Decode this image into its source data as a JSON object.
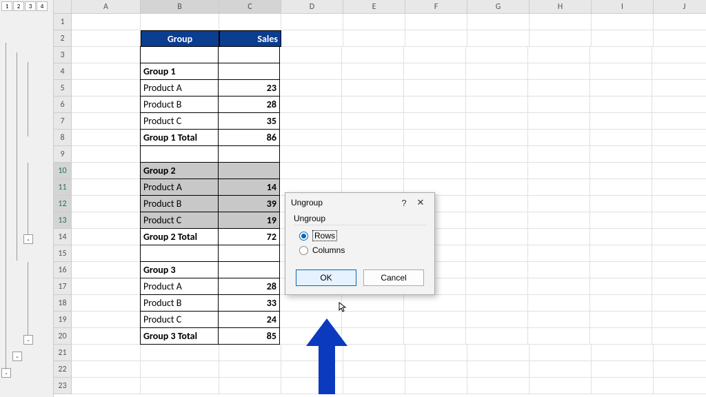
{
  "outline_levels": [
    "1",
    "2",
    "3",
    "4"
  ],
  "columns": [
    "A",
    "B",
    "C",
    "D",
    "E",
    "F",
    "G",
    "H",
    "I",
    "J"
  ],
  "col_widths": {
    "A": 100,
    "B": 114,
    "C": 90,
    "default": 90
  },
  "rows": [
    {
      "num": "1"
    },
    {
      "num": "2",
      "B": "Group",
      "C": "Sales",
      "header": true
    },
    {
      "num": "3",
      "bordered": true
    },
    {
      "num": "4",
      "B": "Group 1",
      "bold": true,
      "bordered": true
    },
    {
      "num": "5",
      "B": "Product A",
      "C": "23",
      "bordered": true
    },
    {
      "num": "6",
      "B": "Product B",
      "C": "28",
      "bordered": true
    },
    {
      "num": "7",
      "B": "Product C",
      "C": "35",
      "bordered": true
    },
    {
      "num": "8",
      "B": "Group 1 Total",
      "C": "86",
      "bold": true,
      "bordered": true
    },
    {
      "num": "9",
      "bordered": true
    },
    {
      "num": "10",
      "B": "Group 2",
      "bold": true,
      "bordered": true,
      "selected": true
    },
    {
      "num": "11",
      "B": "Product A",
      "C": "14",
      "bordered": true,
      "selected": true
    },
    {
      "num": "12",
      "B": "Product B",
      "C": "39",
      "bordered": true,
      "selected": true
    },
    {
      "num": "13",
      "B": "Product C",
      "C": "19",
      "bordered": true,
      "selected": true
    },
    {
      "num": "14",
      "B": "Group 2 Total",
      "C": "72",
      "bold": true,
      "bordered": true
    },
    {
      "num": "15",
      "bordered": true
    },
    {
      "num": "16",
      "B": "Group 3",
      "bold": true,
      "bordered": true
    },
    {
      "num": "17",
      "B": "Product A",
      "C": "28",
      "bordered": true
    },
    {
      "num": "18",
      "B": "Product B",
      "C": "33",
      "bordered": true
    },
    {
      "num": "19",
      "B": "Product C",
      "C": "24",
      "bordered": true
    },
    {
      "num": "20",
      "B": "Group 3 Total",
      "C": "85",
      "bold": true,
      "bordered": true
    },
    {
      "num": "21"
    },
    {
      "num": "22"
    },
    {
      "num": "23"
    }
  ],
  "dialog": {
    "title": "Ungroup",
    "section": "Ungroup",
    "option_rows": "Rows",
    "option_columns": "Columns",
    "ok": "OK",
    "cancel": "Cancel"
  },
  "collapse_symbol": "-"
}
